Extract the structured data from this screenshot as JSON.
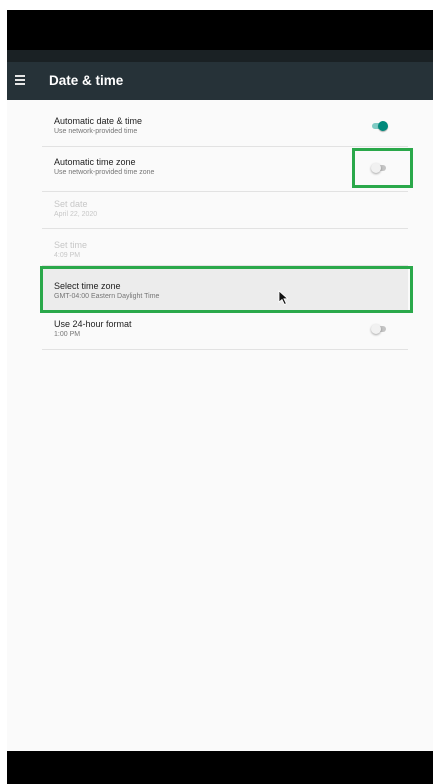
{
  "appbar": {
    "title": "Date & time",
    "menu_icon": "menu-icon"
  },
  "settings": [
    {
      "title": "Automatic date & time",
      "summary": "Use network-provided time",
      "control": "switch",
      "checked": true,
      "enabled": true
    },
    {
      "title": "Automatic time zone",
      "summary": "Use network-provided time zone",
      "control": "switch",
      "checked": false,
      "enabled": true
    },
    {
      "title": "Set date",
      "summary": "April 22, 2020",
      "control": "none",
      "enabled": false
    },
    {
      "title": "Set time",
      "summary": "4:09 PM",
      "control": "none",
      "enabled": false
    },
    {
      "title": "Select time zone",
      "summary": "GMT-04:00 Eastern Daylight Time",
      "control": "none",
      "enabled": true
    },
    {
      "title": "Use 24-hour format",
      "summary": "1:00 PM",
      "control": "switch",
      "checked": false,
      "enabled": true
    }
  ],
  "colors": {
    "accent": "#00897b",
    "appbar": "#263238",
    "highlight_box": "#2aa84a"
  }
}
